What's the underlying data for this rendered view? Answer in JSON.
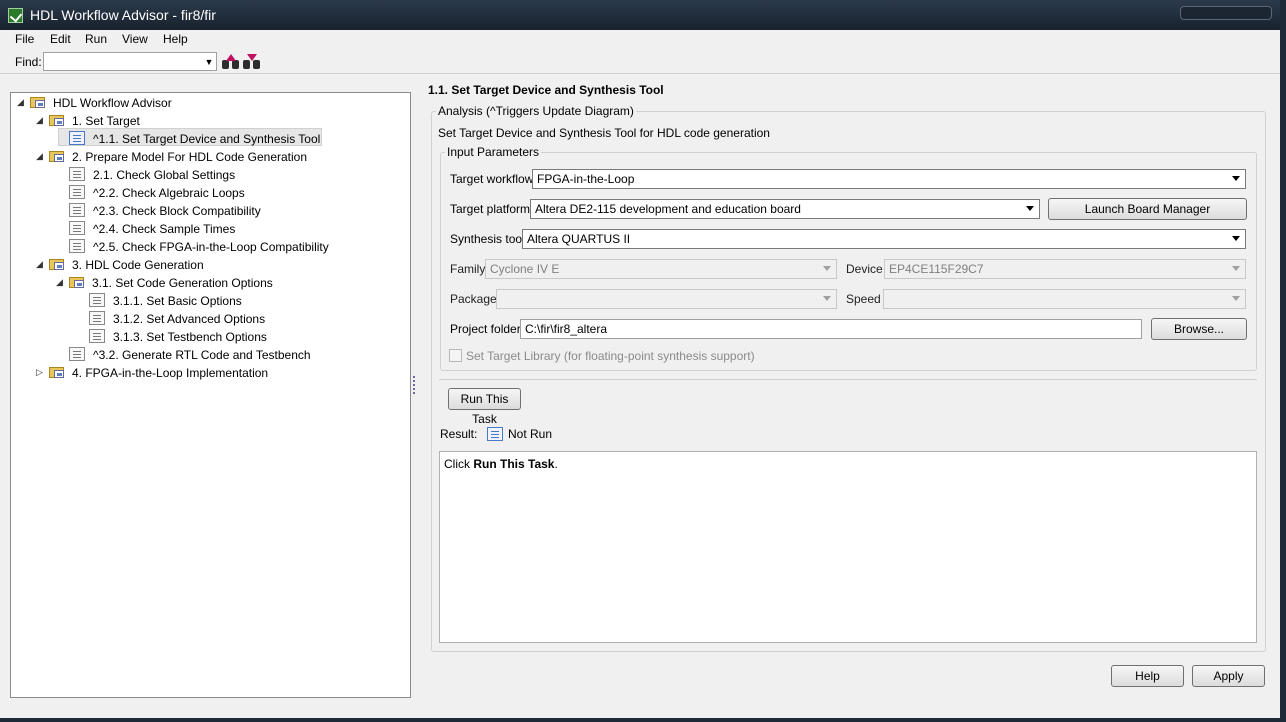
{
  "window": {
    "title": "HDL Workflow Advisor - fir8/fir"
  },
  "menu": [
    "File",
    "Edit",
    "Run",
    "View",
    "Help"
  ],
  "find": {
    "label": "Find:",
    "value": ""
  },
  "tree": [
    {
      "label": "HDL Workflow Advisor"
    },
    {
      "label": "1. Set Target"
    },
    {
      "label": "^1.1. Set Target Device and Synthesis Tool"
    },
    {
      "label": "2. Prepare Model For HDL Code Generation"
    },
    {
      "label": "2.1. Check Global Settings"
    },
    {
      "label": "^2.2. Check Algebraic Loops"
    },
    {
      "label": "^2.3. Check Block Compatibility"
    },
    {
      "label": "^2.4. Check Sample Times"
    },
    {
      "label": "^2.5. Check FPGA-in-the-Loop Compatibility"
    },
    {
      "label": "3. HDL Code Generation"
    },
    {
      "label": "3.1. Set Code Generation Options"
    },
    {
      "label": "3.1.1. Set Basic Options"
    },
    {
      "label": "3.1.2. Set Advanced Options"
    },
    {
      "label": "3.1.3. Set Testbench Options"
    },
    {
      "label": "^3.2. Generate RTL Code and Testbench"
    },
    {
      "label": "4. FPGA-in-the-Loop Implementation"
    }
  ],
  "content": {
    "heading": "1.1. Set Target Device and Synthesis Tool",
    "analysis_title": "Analysis (^Triggers Update Diagram)",
    "description": "Set Target Device and Synthesis Tool for HDL code generation",
    "input_params_title": "Input Parameters",
    "target_workflow": {
      "label": "Target workflow",
      "value": "FPGA-in-the-Loop"
    },
    "target_platform": {
      "label": "Target platform",
      "value": "Altera DE2-115 development and education board"
    },
    "launch_board_manager": "Launch Board Manager",
    "synthesis_tool": {
      "label": "Synthesis tool",
      "value": "Altera QUARTUS II"
    },
    "family": {
      "label": "Family",
      "value": "Cyclone IV E"
    },
    "device": {
      "label": "Device",
      "value": "EP4CE115F29C7"
    },
    "package": {
      "label": "Package",
      "value": ""
    },
    "speed": {
      "label": "Speed",
      "value": ""
    },
    "project_folder": {
      "label": "Project folder",
      "value": "C:\\fir\\fir8_altera"
    },
    "browse": "Browse...",
    "set_target_library": "Set Target Library (for floating-point synthesis support)",
    "run_task": "Run This Task",
    "result_label": "Result:",
    "result_value": "Not Run",
    "result_text_prefix": "Click ",
    "result_text_bold": "Run This Task",
    "result_text_suffix": "."
  },
  "buttons": {
    "help": "Help",
    "apply": "Apply"
  }
}
